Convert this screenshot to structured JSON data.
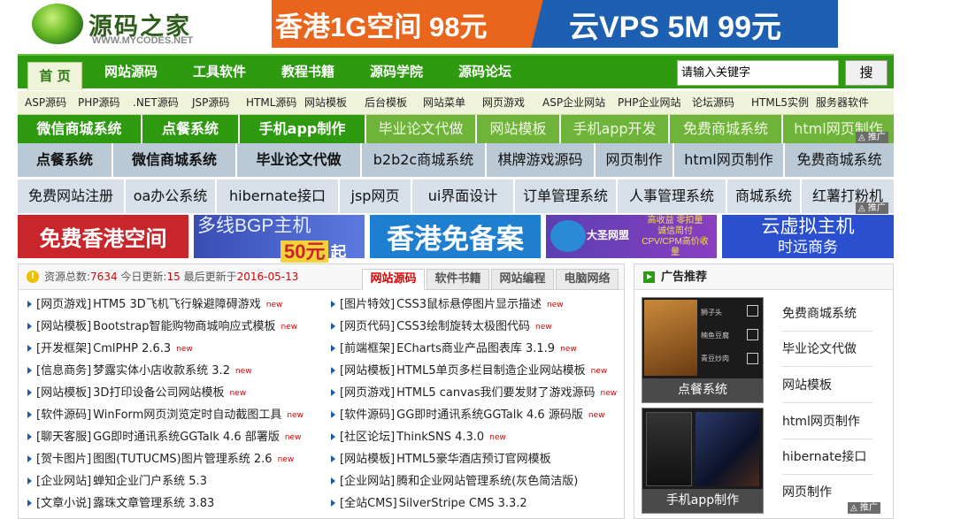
{
  "header": {
    "logo_text": "源码之家",
    "logo_sub": "WWW.MYCODES.NET",
    "banner_left": "香港1G空间 98元",
    "banner_right": "云VPS 5M 99元"
  },
  "nav": {
    "items": [
      "首 页",
      "网站源码",
      "工具软件",
      "教程书籍",
      "源码学院",
      "源码论坛"
    ],
    "search_placeholder": "请输入关键字",
    "search_button": "搜"
  },
  "subnav": [
    "ASP源码",
    "PHP源码",
    ".NET源码",
    "JSP源码",
    "HTML源码",
    "网站模板",
    "后台模板",
    "网站菜单",
    "网页游戏",
    "ASP企业网站",
    "PHP企业网站",
    "论坛源码",
    "HTML5实例",
    "服务器软件"
  ],
  "tags_row1": [
    "微信商城系统",
    "点餐系统",
    "手机app制作",
    "毕业论文代做",
    "网站模板",
    "手机app开发",
    "免费商城系统",
    "html网页制作"
  ],
  "tags_row2": [
    "点餐系统",
    "微信商城系统",
    "毕业论文代做",
    "b2b2c商城系统",
    "棋牌游戏源码",
    "网页制作",
    "html网页制作",
    "免费商城系统"
  ],
  "tags_row3": [
    "免费网站注册",
    "oa办公系统",
    "hibernate接口",
    "jsp网页",
    "ui界面设计",
    "订单管理系统",
    "人事管理系统",
    "商城系统",
    "红薯打粉机"
  ],
  "ad_tag": "推广",
  "banners": {
    "b1": "免费香港空间",
    "b2_line1": "多线BGP主机",
    "b2_price": "50元",
    "b2_suffix": "起",
    "b3": "香港免备案",
    "b4_brand": "大圣网盟",
    "b4_line1": "高收益 零扣量",
    "b4_line2": "诚信周付",
    "b4_line3": "CPV/CPM高价收量",
    "b5_line1": "云虚拟主机",
    "b5_line2": "时远商务"
  },
  "news": {
    "stats_label1": "资源总数:",
    "stats_total": "7634",
    "stats_label2": "今日更新:",
    "stats_today": "15",
    "stats_label3": "最后更新于",
    "stats_date": "2016-05-13",
    "tabs": [
      "网站源码",
      "软件书籍",
      "网站编程",
      "电脑网络"
    ],
    "new_label": "new",
    "left": [
      {
        "cat": "[网页游戏]",
        "title": "HTM5 3D飞机飞行躲避障碍游戏",
        "new": true
      },
      {
        "cat": "[网站模板]",
        "title": "Bootstrap智能购物商城响应式模板",
        "new": true
      },
      {
        "cat": "[开发框架]",
        "title": "CmlPHP 2.6.3",
        "new": true
      },
      {
        "cat": "[信息商务]",
        "title": "梦露实体小店收款系统 3.2",
        "new": true
      },
      {
        "cat": "[网站模板]",
        "title": "3D打印设备公司网站模板",
        "new": true
      },
      {
        "cat": "[软件源码]",
        "title": "WinForm网页浏览定时自动截图工具",
        "new": true
      },
      {
        "cat": "[聊天客服]",
        "title": "GG即时通讯系统GGTalk 4.6 部署版",
        "new": true
      },
      {
        "cat": "[贺卡图片]",
        "title": "图图(TUTUCMS)图片管理系统 2.6",
        "new": true
      },
      {
        "cat": "[企业网站]",
        "title": "蝉知企业门户系统 5.3",
        "new": false
      },
      {
        "cat": "[文章小说]",
        "title": "露珠文章管理系统 3.83",
        "new": false
      }
    ],
    "right": [
      {
        "cat": "[图片特效]",
        "title": "CSS3鼠标悬停图片显示描述",
        "new": true
      },
      {
        "cat": "[网页代码]",
        "title": "CSS3绘制旋转太极图代码",
        "new": true
      },
      {
        "cat": "[前端框架]",
        "title": "ECharts商业产品图表库 3.1.9",
        "new": true
      },
      {
        "cat": "[网站模板]",
        "title": "HTML5单页多栏目制造企业网站模板",
        "new": true
      },
      {
        "cat": "[网页游戏]",
        "title": "HTML5 canvas我们要发财了游戏源码",
        "new": true
      },
      {
        "cat": "[软件源码]",
        "title": "GG即时通讯系统GGTalk 4.6 源码版",
        "new": true
      },
      {
        "cat": "[社区论坛]",
        "title": "ThinkSNS 4.3.0",
        "new": true
      },
      {
        "cat": "[网站模板]",
        "title": "HTML5豪华酒店预订官网模板",
        "new": false
      },
      {
        "cat": "[企业网站]",
        "title": "腾和企业网站管理系统(灰色简洁版)",
        "new": false
      },
      {
        "cat": "[全站CMS]",
        "title": "SilverStripe CMS 3.3.2",
        "new": false
      }
    ]
  },
  "adbox": {
    "title": "广告推荐",
    "thumb1_caption": "点餐系统",
    "thumb2_caption": "手机app制作",
    "thumb1_items": [
      "狮子头",
      "楠鱼豆腐",
      "青豆炒肉"
    ],
    "links": [
      "免费商城系统",
      "毕业论文代做",
      "网站模板",
      "html网页制作",
      "hibernate接口",
      "网页制作"
    ]
  }
}
